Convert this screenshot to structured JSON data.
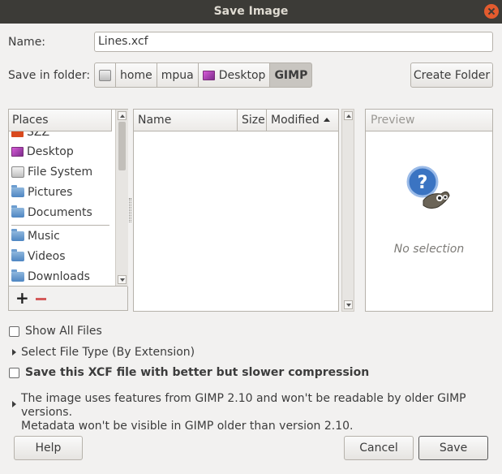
{
  "window": {
    "title": "Save Image"
  },
  "name_row": {
    "label": "Name:",
    "value": "Lines.xcf"
  },
  "folder_row": {
    "label": "Save in folder:",
    "crumbs": [
      "home",
      "mpua",
      "Desktop",
      "GIMP"
    ],
    "create_folder": "Create Folder"
  },
  "places": {
    "header": "Places",
    "items": [
      {
        "label": "Desktop",
        "icon": "desktop-icon"
      },
      {
        "label": "File System",
        "icon": "drive-icon"
      },
      {
        "label": "Pictures",
        "icon": "folder-icon"
      },
      {
        "label": "Documents",
        "icon": "folder-icon"
      },
      {
        "label": "Music",
        "icon": "folder-icon"
      },
      {
        "label": "Videos",
        "icon": "folder-icon"
      },
      {
        "label": "Downloads",
        "icon": "folder-icon"
      }
    ],
    "partial_item": "SZZ",
    "add_symbol": "+"
  },
  "files": {
    "columns": [
      "Name",
      "Size",
      "Modified"
    ],
    "sort_column": "Modified",
    "sort_direction": "ascending"
  },
  "preview": {
    "header": "Preview",
    "empty_text": "No selection"
  },
  "options": {
    "show_all_files": "Show All Files",
    "select_file_type": "Select File Type (By Extension)",
    "compression": "Save this XCF file with better but slower compression"
  },
  "message": {
    "line1": "The image uses features from GIMP 2.10 and won't be readable by older GIMP versions.",
    "line2": "Metadata won't be visible in GIMP older than version 2.10."
  },
  "buttons": {
    "help": "Help",
    "cancel": "Cancel",
    "save": "Save"
  },
  "colors": {
    "titlebar": "#3c3b37",
    "close": "#e35b2e",
    "background": "#f2f1f0"
  }
}
